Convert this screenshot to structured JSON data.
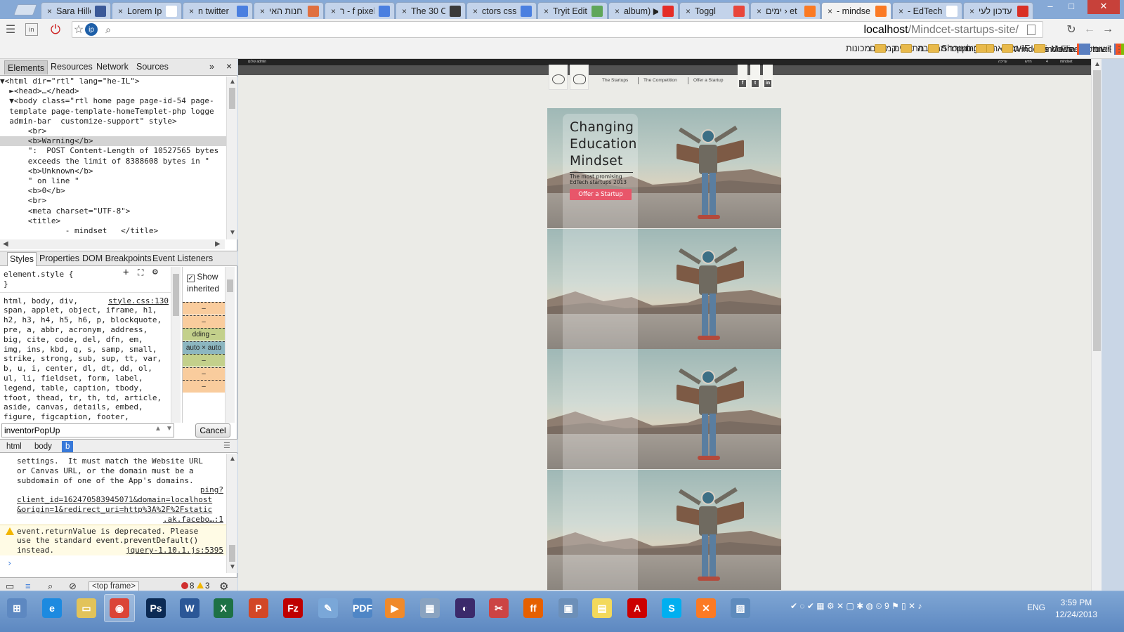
{
  "tabs": [
    {
      "title": "Sara Hille",
      "favicon": "facebook-icon",
      "color": "#3b5998"
    },
    {
      "title": "Lorem Ip",
      "favicon": "lorem-icon",
      "color": "#ffffff"
    },
    {
      "title": "n twitter",
      "favicon": "google-icon",
      "color": "#4a7fe0"
    },
    {
      "title": "חנות האי",
      "favicon": "store-icon",
      "color": "#e07040"
    },
    {
      "title": "ר - f pixel",
      "favicon": "google-icon",
      "color": "#4a7fe0"
    },
    {
      "title": "The 30 C",
      "favicon": "puzzle-icon",
      "color": "#3a3a3a"
    },
    {
      "title": "ctors css",
      "favicon": "google-icon",
      "color": "#4a7fe0"
    },
    {
      "title": "Tryit Edit",
      "favicon": "w3-icon",
      "color": "#5fa65a"
    },
    {
      "title": "album) ▶",
      "favicon": "youtube-icon",
      "color": "#e52d27"
    },
    {
      "title": "Toggl",
      "favicon": "toggl-icon",
      "color": "#e8463b"
    },
    {
      "title": "ימים › et",
      "favicon": "xampp-icon",
      "color": "#fb7a24"
    },
    {
      "title": "- mindse",
      "favicon": "xampp-icon",
      "color": "#fb7a24",
      "active": true
    },
    {
      "title": "- EdTech",
      "favicon": "page-icon",
      "color": "#ffffff"
    },
    {
      "title": "עדכון לעי",
      "favicon": "gmail-icon",
      "color": "#d93025"
    }
  ],
  "window_controls": {
    "minimize": "‒",
    "maximize": "□",
    "close": "✕"
  },
  "address": {
    "host": "localhost",
    "path": "/Mindcet-startups-site/"
  },
  "bookmarks": [
    {
      "label": "ישומים",
      "icon": "apps-icon"
    },
    {
      "label": "Free Hotmail",
      "icon": "windows-icon"
    },
    {
      "label": "Windows",
      "icon": "windows-icon"
    },
    {
      "label": "Windows Media",
      "icon": "media-icon"
    },
    {
      "label": "מיובא מ-IE",
      "icon": "folder-icon"
    },
    {
      "label": "תחביבים",
      "icon": "folder-icon"
    },
    {
      "label": "Shopping",
      "icon": "folder-icon"
    },
    {
      "label": "מעורר מחשבה",
      "icon": "folder-icon"
    },
    {
      "label": "מתכונים",
      "icon": "folder-icon"
    },
    {
      "label": "קמביום",
      "icon": "folder-icon"
    },
    {
      "label": "מכונות",
      "icon": "folder-icon"
    }
  ],
  "devtools": {
    "tabs": [
      "Elements",
      "Resources",
      "Network",
      "Sources"
    ],
    "more": "»",
    "close": "×",
    "dom_lines": [
      "▼<html dir=\"rtl\" lang=\"he-IL\">",
      "  ►<head>…</head>",
      "  ▼<body class=\"rtl home page page-id-54 page-",
      "  template page-template-homeTemplet-php logge",
      "  admin-bar  customize-support\" style>",
      "      <br>",
      "      <b>Warning</b>",
      "      \":  POST Content-Length of 10527565 bytes",
      "      exceeds the limit of 8388608 bytes in \"",
      "      <b>Unknown</b>",
      "      \" on line \"",
      "      <b>0</b>",
      "      <br>",
      "      <meta charset=\"UTF-8\">",
      "      <title>",
      "              - mindset   </title>"
    ],
    "style_tabs": [
      "Styles",
      "Properties",
      "DOM Breakpoints",
      "Event Listeners"
    ],
    "element_style": "element.style {",
    "element_style_close": "}",
    "style_source": "style.css:130",
    "selector_lines": [
      "html, body, div,",
      "span, applet, object, iframe, h1,",
      "h2, h3, h4, h5, h6, p, blockquote,",
      "pre, a, abbr, acronym, address,",
      "big, cite, code, del, dfn, em,",
      "img, ins, kbd, q, s, samp, small,",
      "strike, strong, sub, sup, tt, var,",
      "b, u, i, center, dl, dt, dd, ol,",
      "ul, li, fieldset, form, label,",
      "legend, table, caption, tbody,",
      "tfoot, thead, tr, th, td, article,",
      "aside, canvas, details, embed,",
      "figure, figcaption, footer,"
    ],
    "show_inherited": "Show inherited",
    "metrics": [
      {
        "label": "–",
        "color": "#f9cc9d"
      },
      {
        "label": "–",
        "color": "#f9cc9d"
      },
      {
        "label": "dding –",
        "color": "#c3d08b"
      },
      {
        "label": "auto × auto",
        "color": "#8cb6c0"
      },
      {
        "label": "–",
        "color": "#c3d08b"
      },
      {
        "label": "–",
        "color": "#f9cc9d"
      },
      {
        "label": "–",
        "color": "#f9cc9d"
      }
    ],
    "search_value": "inventorPopUp",
    "cancel_label": "Cancel",
    "breadcrumbs": [
      "html",
      "body",
      "b"
    ],
    "console_lines": [
      "settings.  It must match the Website URL",
      "or Canvas URL, or the domain must be a",
      "subdomain of one of the App's domains."
    ],
    "console_links": [
      "ping?",
      "client_id=162470583945071&domain=localhost",
      "&origin=1&redirect_uri=http%3A%2F%2Fstatic",
      ".ak.facebo…:1"
    ],
    "warning_lines": [
      "event.returnValue is deprecated. Please",
      "use the standard event.preventDefault()",
      "instead."
    ],
    "warning_link": "jquery-1.10.1.js:5395",
    "prompt": "›",
    "frame_select": "<top frame>",
    "errors": "8",
    "warnings": "3"
  },
  "site": {
    "admin_items": [
      "שלום admin",
      "mindset",
      "4",
      "חדש",
      "עריכה"
    ],
    "nav": [
      "The Startups",
      "The Competition",
      "Offer a Startup"
    ],
    "social": [
      "f",
      "t",
      "in"
    ],
    "hero_title_lines": [
      "Changing",
      "Education",
      "Mindset"
    ],
    "hero_subtitle": "The most promising EdTech startups 2013",
    "hero_button": "Offer a Startup"
  },
  "taskbar": {
    "apps": [
      {
        "name": "start-icon",
        "label": "⊞",
        "color": "#5d88c1"
      },
      {
        "name": "ie-icon",
        "label": "e",
        "color": "#1d8ae0"
      },
      {
        "name": "explorer-icon",
        "label": "▭",
        "color": "#e2c35a"
      },
      {
        "name": "chrome-icon",
        "label": "◉",
        "color": "#db4437",
        "open": true
      },
      {
        "name": "photoshop-icon",
        "label": "Ps",
        "color": "#0b2a54"
      },
      {
        "name": "word-icon",
        "label": "W",
        "color": "#2b5797"
      },
      {
        "name": "excel-icon",
        "label": "X",
        "color": "#1e7145"
      },
      {
        "name": "powerpoint-icon",
        "label": "P",
        "color": "#d24726"
      },
      {
        "name": "filezilla-icon",
        "label": "Fz",
        "color": "#bf0000"
      },
      {
        "name": "paint-icon",
        "label": "✎",
        "color": "#7aa7d8"
      },
      {
        "name": "pdf-icon",
        "label": "PDF",
        "color": "#4f86c6"
      },
      {
        "name": "media-icon",
        "label": "▶",
        "color": "#f08a2b"
      },
      {
        "name": "calculator-icon",
        "label": "▦",
        "color": "#8aa3c0"
      },
      {
        "name": "eclipse-icon",
        "label": "◐",
        "color": "#3b2a6b"
      },
      {
        "name": "snipping-icon",
        "label": "✂",
        "color": "#c44"
      },
      {
        "name": "firefox-icon",
        "label": "ff",
        "color": "#e66000"
      },
      {
        "name": "virtualbox-icon",
        "label": "▣",
        "color": "#6c8fb8"
      },
      {
        "name": "notes-icon",
        "label": "▤",
        "color": "#f3d95b"
      },
      {
        "name": "acrobat-icon",
        "label": "A",
        "color": "#c00"
      },
      {
        "name": "skype-icon",
        "label": "S",
        "color": "#00aff0"
      },
      {
        "name": "xampp-icon",
        "label": "✕",
        "color": "#fb7a24"
      },
      {
        "name": "photos-icon",
        "label": "▨",
        "color": "#5e8bbd"
      }
    ],
    "language": "ENG",
    "time": "3:59 PM",
    "date": "12/24/2013"
  }
}
